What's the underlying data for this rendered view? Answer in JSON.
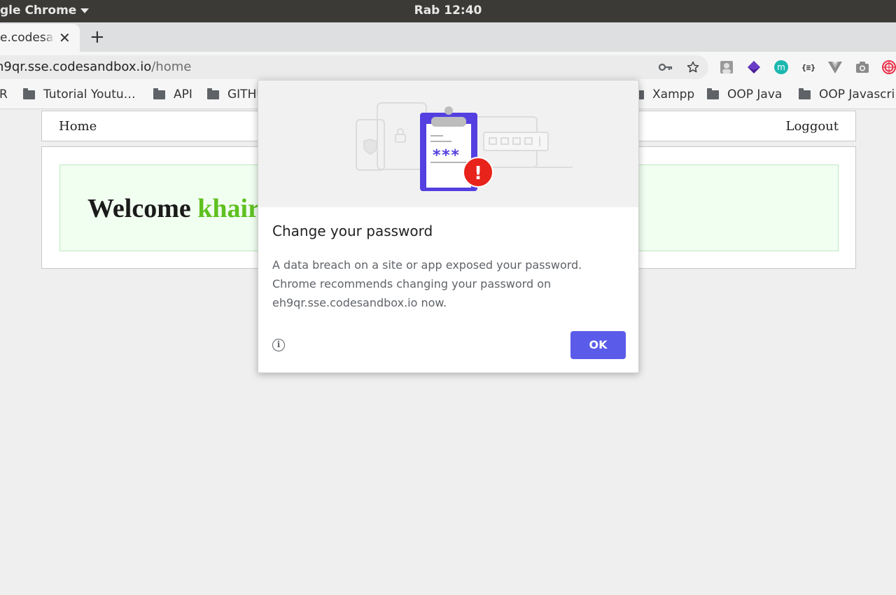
{
  "topbar": {
    "app_name": "gle Chrome",
    "clock": "Rab 12:40"
  },
  "tab": {
    "title": "e.codesandbox.io",
    "close": "✕",
    "new_tab": "+"
  },
  "address": {
    "host": "h9qr.sse.codesandbox.io",
    "path": "/home"
  },
  "extensions": [
    "key-icon",
    "star-icon",
    "profile-extension-icon",
    "purple-gem-extension-icon",
    "m-extension-icon",
    "json-extension-icon",
    "vue-devtools-icon",
    "camera-icon",
    "swirl-extension-icon"
  ],
  "extension_labels": {
    "m": "m",
    "json": "{≡}"
  },
  "bookmarks": [
    {
      "label": "R"
    },
    {
      "label": "Tutorial Youtu…"
    },
    {
      "label": "API"
    },
    {
      "label": "GITHU"
    },
    {
      "label": "Xampp"
    },
    {
      "label": "OOP Java"
    },
    {
      "label": "OOP Javascri"
    }
  ],
  "page": {
    "nav_home": "Home",
    "nav_logout": "Loggout",
    "welcome_word": "Welcome",
    "welcome_name": "khair"
  },
  "dialog": {
    "title": "Change your password",
    "body_line1": "A data breach on a site or app exposed your password.",
    "body_line2": "Chrome recommends changing your password on",
    "body_line3": "eh9qr.sse.codesandbox.io now.",
    "info_glyph": "i",
    "ok_label": "OK",
    "illustration_password": "***",
    "illustration_alert": "!"
  },
  "colors": {
    "accent": "#5b5bea",
    "alert_red": "#e8231b",
    "welcome_name": "#5fc01f"
  }
}
